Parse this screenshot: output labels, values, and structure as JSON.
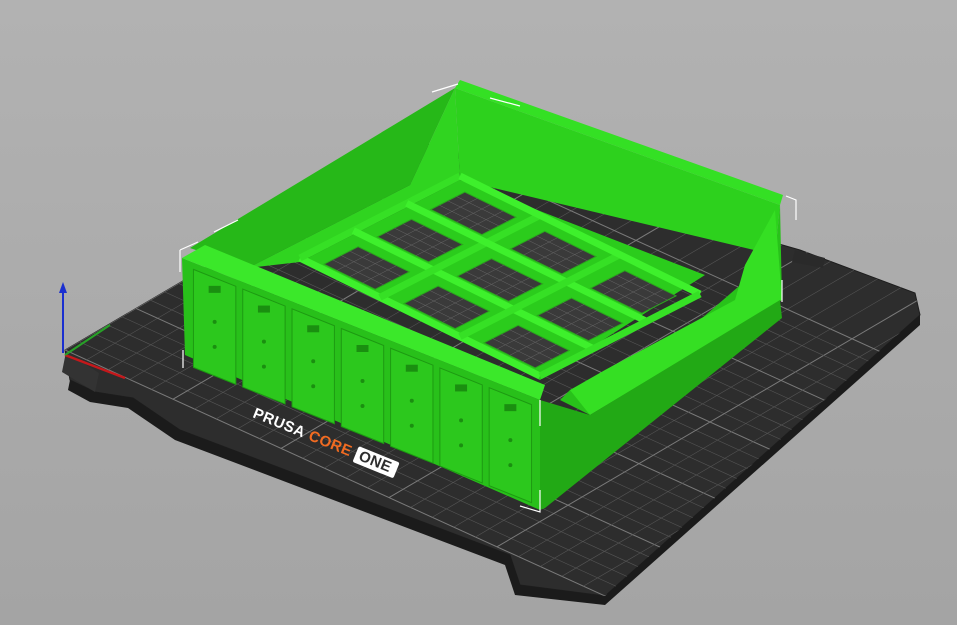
{
  "viewport": {
    "background_color": "#ababab",
    "bed_color": "#2e2e2e",
    "model_color": "#2fd31f",
    "model_shadow_color": "#1f9e14",
    "grid_color": "#6a6a6a",
    "bed_grid_fine": "#505050"
  },
  "bed_logo": {
    "word1": "PRUSA",
    "word2": "CORE",
    "word3": "ONE",
    "word1_color": "#ffffff",
    "word2_color": "#f26b21",
    "word3_color": "#2e2e2e",
    "word3_bg": "#ffffff"
  },
  "axes": {
    "x_color": "#c4181b",
    "y_color": "#27a127",
    "z_color": "#1a2fd0"
  },
  "model": {
    "type": "storage-tray",
    "grid_cells": 9,
    "drawers_front": 7
  }
}
